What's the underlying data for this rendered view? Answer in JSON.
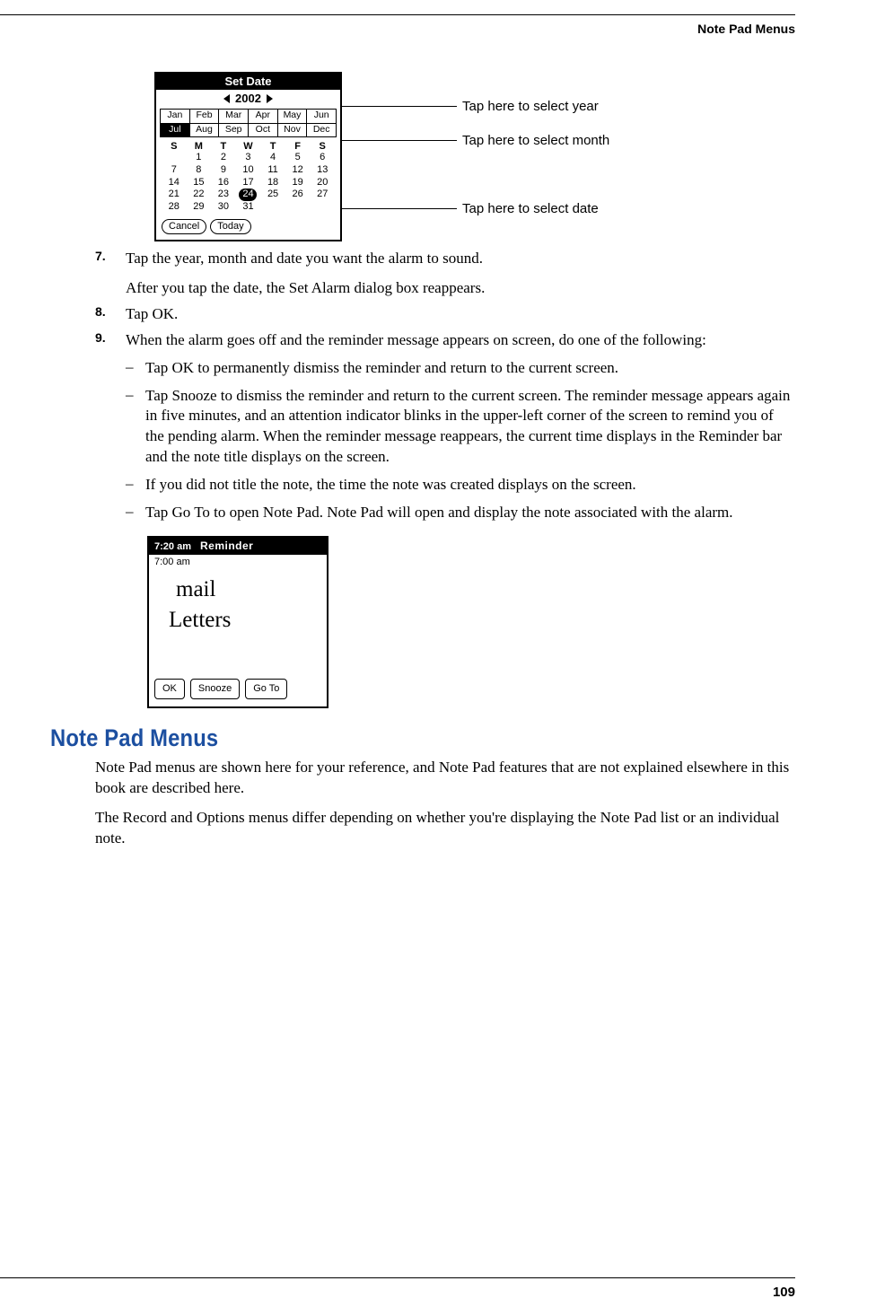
{
  "running_head": "Note Pad Menus",
  "page_number": "109",
  "fig1": {
    "title": "Set Date",
    "year": "2002",
    "months": [
      "Jan",
      "Feb",
      "Mar",
      "Apr",
      "May",
      "Jun",
      "Jul",
      "Aug",
      "Sep",
      "Oct",
      "Nov",
      "Dec"
    ],
    "selected_month_index": 6,
    "dow": [
      "S",
      "M",
      "T",
      "W",
      "T",
      "F",
      "S"
    ],
    "days_leading_blanks": 1,
    "days": [
      "1",
      "2",
      "3",
      "4",
      "5",
      "6",
      "7",
      "8",
      "9",
      "10",
      "11",
      "12",
      "13",
      "14",
      "15",
      "16",
      "17",
      "18",
      "19",
      "20",
      "21",
      "22",
      "23",
      "24",
      "25",
      "26",
      "27",
      "28",
      "29",
      "30",
      "31"
    ],
    "selected_day": "24",
    "buttons": {
      "cancel": "Cancel",
      "today": "Today"
    },
    "callouts": {
      "year": "Tap here to select year",
      "month": "Tap here to select month",
      "date": "Tap here to select date"
    }
  },
  "steps": {
    "s7_num": "7.",
    "s7": "Tap the year, month and date you want the alarm to sound.",
    "s7_follow": "After you tap the date, the Set Alarm dialog box reappears.",
    "s8_num": "8.",
    "s8": "Tap OK.",
    "s9_num": "9.",
    "s9": "When the alarm goes off and the reminder message appears on screen, do one of the following:",
    "dash_a": "Tap OK to permanently dismiss the reminder and return to the current screen.",
    "dash_b": "Tap Snooze to dismiss the reminder and return to the current screen. The reminder message appears again in five minutes, and an attention indicator blinks in the upper-left corner of the screen to remind you of the pending alarm. When the reminder message reappears, the current time displays in the Reminder bar and the note title displays on the screen.",
    "dash_c": "If you did not title the note, the time the note was created displays on the screen.",
    "dash_d": "Tap Go To to open Note Pad. Note Pad will open and display the note associated with the alarm."
  },
  "fig2": {
    "bar_time": "7:20 am",
    "bar_label": "Reminder",
    "note_time": "7:00 am",
    "hw_line1": "mail",
    "hw_line2": "Letters",
    "buttons": {
      "ok": "OK",
      "snooze": "Snooze",
      "goto": "Go To"
    }
  },
  "section": {
    "heading": "Note Pad Menus",
    "p1": "Note Pad menus are shown here for your reference, and Note Pad features that are not explained elsewhere in this book are described here.",
    "p2": "The Record and Options menus differ depending on whether you're displaying the Note Pad list or an individual note."
  }
}
